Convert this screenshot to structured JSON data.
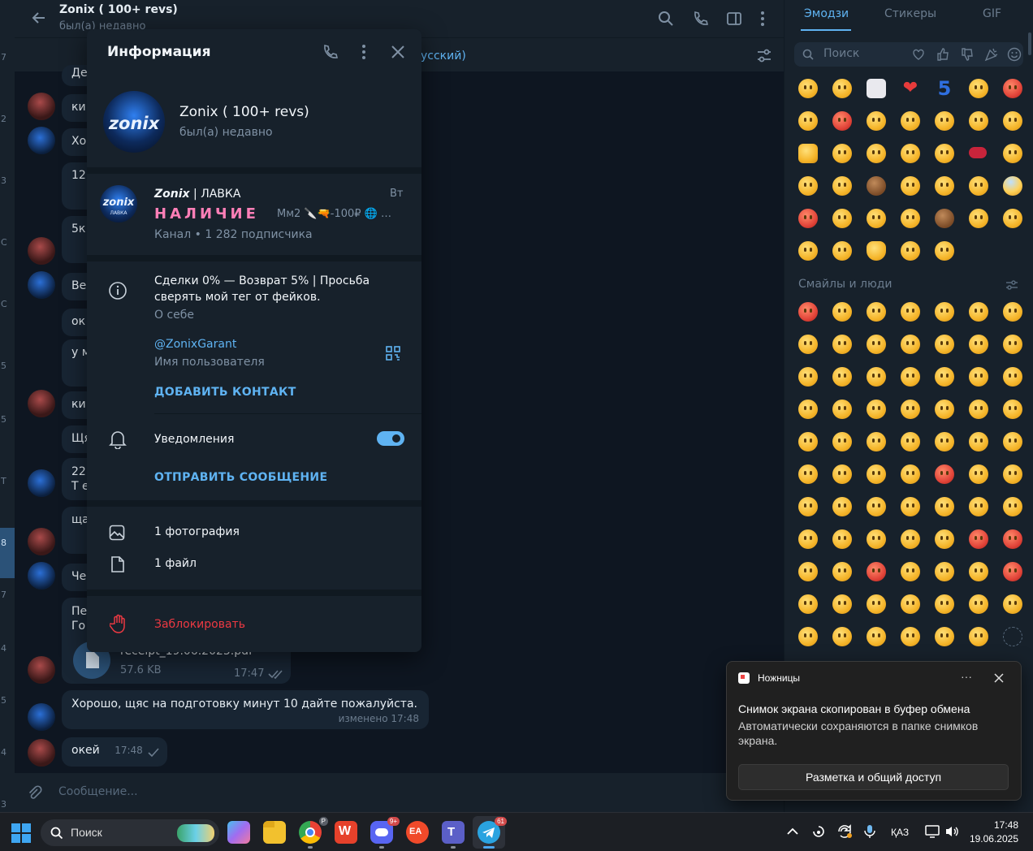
{
  "chat": {
    "title": "Zonix ( 100+ revs)",
    "status": "был(а) недавно",
    "pinned_fragment": "усский)",
    "messages": [
      {
        "text": "Хорошо, щяс на подготовку минут 10 дайте пожалуйста.",
        "meta": "изменено 17:48"
      },
      {
        "text": "окей",
        "meta": "17:48"
      }
    ],
    "file": {
      "name": "receipt_19.06.2025.pdf",
      "size": "57.6 KB",
      "time": "17:47"
    },
    "truncated": [
      "Де",
      "ки",
      "Хо",
      "12",
      "5к",
      "Ве",
      "ок",
      "у м",
      "ки",
      "Щя",
      "22",
      "Т е",
      "ща",
      "Че",
      "Пе",
      "Го"
    ],
    "composer_placeholder": "Сообщение..."
  },
  "left_strip_numbers": [
    "7",
    "2",
    "3",
    "C",
    "C",
    "5",
    "5",
    "T",
    "8",
    "7",
    "4",
    "5",
    "4",
    "3"
  ],
  "info_modal": {
    "heading": "Информация",
    "profile_name": "Zonix ( 100+ revs)",
    "profile_status": "был(а) недавно",
    "avatar_text": "zonix",
    "channel": {
      "title_bold": "Zonix",
      "title_rest": " | ЛАВКА",
      "day": "Вт",
      "styled_word": "НАЛИЧИЕ",
      "preview": "Мм2 🔪🔫-100₽ 🌐 …",
      "subscribers": "Канал • 1 282 подписчика",
      "avatar_text": "zonix",
      "avatar_sub": "ЛАВКА"
    },
    "bio": "Сделки 0% — Возврат 5% | Просьба сверять мой тег от фейков.",
    "bio_label": "О себе",
    "username": "@ZonixGarant",
    "username_label": "Имя пользователя",
    "add_contact": "ДОБАВИТЬ КОНТАКТ",
    "notifications": "Уведомления",
    "notifications_on": true,
    "send_message": "ОТПРАВИТЬ СООБЩЕНИЕ",
    "photos": "1 фотография",
    "files": "1 файл",
    "block": "Заблокировать"
  },
  "emoji_panel": {
    "tabs": [
      "Эмодзи",
      "Стикеры",
      "GIF"
    ],
    "active_tab": "Эмодзи",
    "search_placeholder": "Поиск",
    "section_title": "Смайлы и люди"
  },
  "toast": {
    "app": "Ножницы",
    "title": "Снимок экрана скопирован в буфер обмена",
    "body": "Автоматически сохраняются в папке снимков экрана.",
    "button": "Разметка и общий доступ"
  },
  "taskbar": {
    "search": "Поиск",
    "lang": "ҚАЗ",
    "time": "17:48",
    "date": "19.06.2025",
    "discord_badge": "9+",
    "telegram_badge": "61",
    "chrome_badge": "P"
  },
  "colors": {
    "accent": "#5fb3f2",
    "danger": "#ec3942",
    "panel": "#17212b",
    "bg": "#0e1621"
  }
}
